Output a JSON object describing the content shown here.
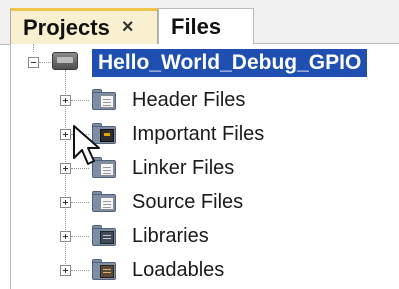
{
  "tabs": [
    {
      "label": "Projects",
      "active": true,
      "closable": true,
      "close_glyph": "×"
    },
    {
      "label": "Files",
      "active": false
    }
  ],
  "tree": {
    "root": {
      "label": "Hello_World_Debug_GPIO",
      "icon": "project-chip-icon",
      "expanded": true,
      "selected": true
    },
    "items": [
      {
        "label": "Header Files",
        "icon": "header-folder-icon"
      },
      {
        "label": "Important Files",
        "icon": "important-folder-icon"
      },
      {
        "label": "Linker Files",
        "icon": "linker-folder-icon"
      },
      {
        "label": "Source Files",
        "icon": "source-folder-icon"
      },
      {
        "label": "Libraries",
        "icon": "libraries-folder-icon"
      },
      {
        "label": "Loadables",
        "icon": "loadables-folder-icon"
      }
    ]
  },
  "colors": {
    "selection": "#1f4fb0",
    "active_tab": "#f8f0cf",
    "active_tab_accent": "#f0c34a"
  }
}
